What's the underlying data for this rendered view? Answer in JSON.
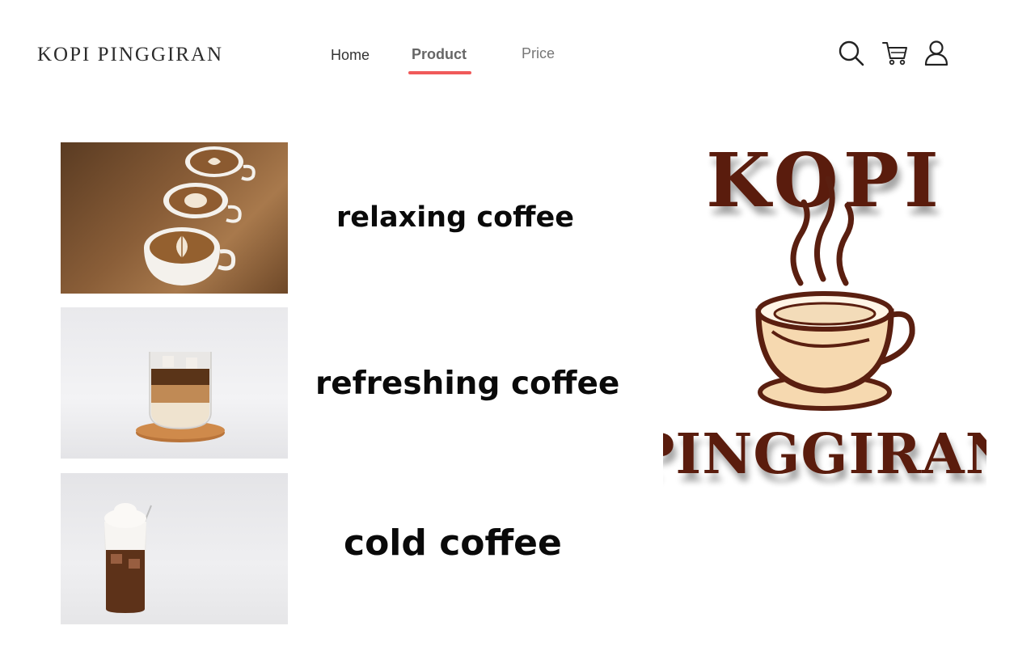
{
  "header": {
    "brand": "KOPI PINGGIRAN",
    "nav": [
      {
        "label": "Home"
      },
      {
        "label": "Product",
        "active": true
      },
      {
        "label": "Price"
      }
    ],
    "icons": [
      "search-icon",
      "cart-icon",
      "user-icon"
    ]
  },
  "products": [
    {
      "label": "relaxing coffee",
      "image": "three-latte-art-cups-on-wood"
    },
    {
      "label": "refreshing coffee",
      "image": "iced-latte-glass-on-coaster"
    },
    {
      "label": "cold coffee",
      "image": "iced-coffee-with-foam-and-straw"
    }
  ],
  "logo": {
    "top_text": "KOPI",
    "bottom_text": "PINGGIRAN"
  },
  "colors": {
    "accent": "#f05a5a",
    "logo_brown": "#5a1f10",
    "logo_cream": "#f6d9b0"
  }
}
